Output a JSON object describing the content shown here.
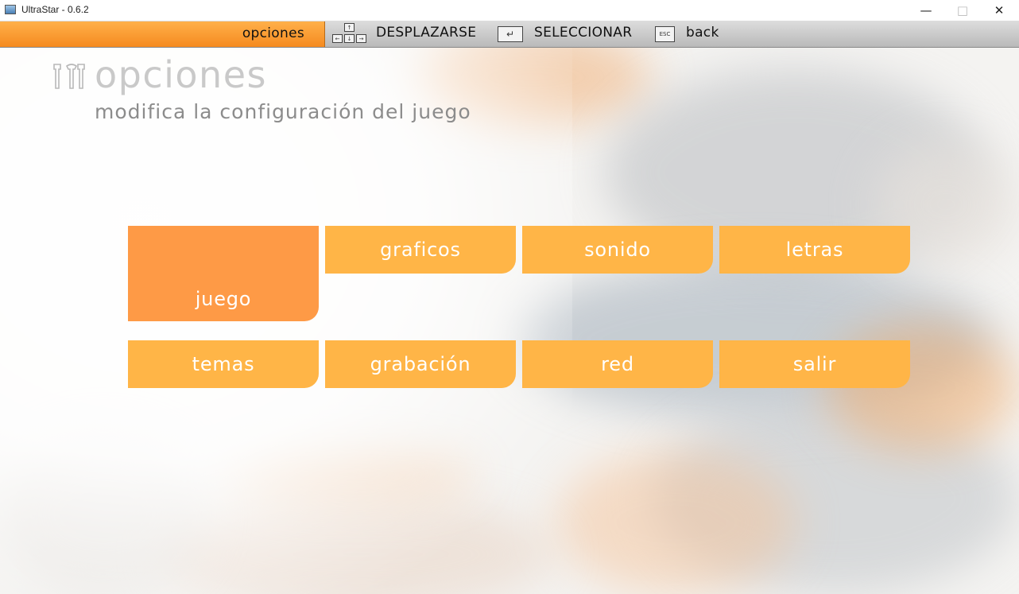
{
  "window": {
    "title": "UltraStar - 0.6.2"
  },
  "topbar": {
    "section": "opciones",
    "hints": [
      {
        "icon": "arrow-keys-icon",
        "label": "DESPLAZARSE"
      },
      {
        "icon": "enter-key-icon",
        "label": "SELECCIONAR"
      },
      {
        "icon": "esc-key-icon",
        "key_text": "ESC",
        "label": "back"
      }
    ]
  },
  "heading": {
    "title": "opciones",
    "subtitle": "modifica la configuración del juego"
  },
  "menu": {
    "items": [
      {
        "label": "juego",
        "selected": true
      },
      {
        "label": "graficos",
        "selected": false
      },
      {
        "label": "sonido",
        "selected": false
      },
      {
        "label": "letras",
        "selected": false
      },
      {
        "label": "temas",
        "selected": false
      },
      {
        "label": "grabación",
        "selected": false
      },
      {
        "label": "red",
        "selected": false
      },
      {
        "label": "salir",
        "selected": false
      }
    ]
  },
  "colors": {
    "button": "#ffb547",
    "button_selected": "#fe9a46",
    "topbar_accent": "#f58a1f"
  }
}
